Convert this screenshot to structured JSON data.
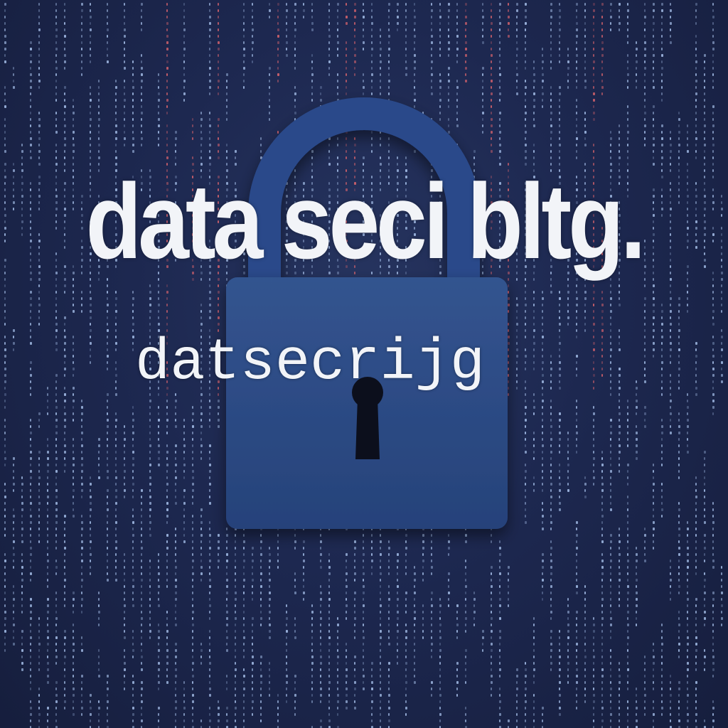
{
  "headline": "data seci bltg.",
  "subline": "datsecrijg",
  "icons": {
    "padlock": "padlock-icon",
    "keyhole": "keyhole-icon"
  },
  "colors": {
    "background": "#1d2850",
    "lock_body": "#2b4a86",
    "lock_shackle": "#2a4a8a",
    "text": "#f2f4f8",
    "rain_blue": "#aac4ee",
    "rain_red": "#e0666e",
    "keyhole": "#0c0f1c"
  }
}
